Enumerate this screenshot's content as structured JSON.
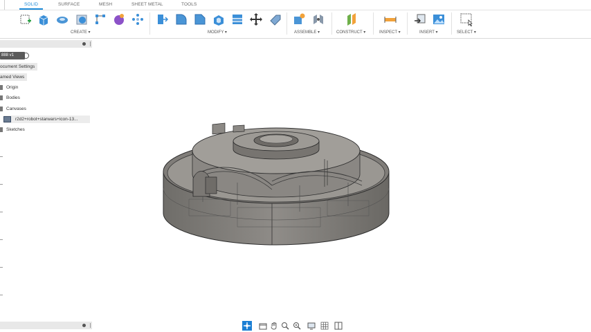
{
  "ribbon": {
    "tabs": [
      {
        "label": "SOLID",
        "active": true
      },
      {
        "label": "SURFACE"
      },
      {
        "label": "MESH"
      },
      {
        "label": "SHEET METAL"
      },
      {
        "label": "TOOLS"
      }
    ],
    "groups": {
      "create": "CREATE ▾",
      "modify": "MODIFY ▾",
      "assemble": "ASSEMBLE ▾",
      "construct": "CONSTRUCT ▾",
      "inspect": "INSPECT ▾",
      "insert": "INSERT ▾",
      "select": "SELECT ▾"
    },
    "accent": "#1c8ad8"
  },
  "browser": {
    "document_title": "888 v1",
    "items": {
      "document_settings": "ocument Settings",
      "named_views": "amed Views",
      "origin": "Origin",
      "bodies": "Bodies",
      "canvases": "Canvases",
      "canvas_item": "r2d2+robot+starwars+icon-13...",
      "sketches": "Sketches"
    }
  },
  "navbar": {
    "icons": [
      "orbit-icon",
      "look-at-icon",
      "pan-icon",
      "zoom-window-icon",
      "zoom-icon",
      "display-settings-icon",
      "grid-settings-icon",
      "viewports-icon"
    ]
  }
}
